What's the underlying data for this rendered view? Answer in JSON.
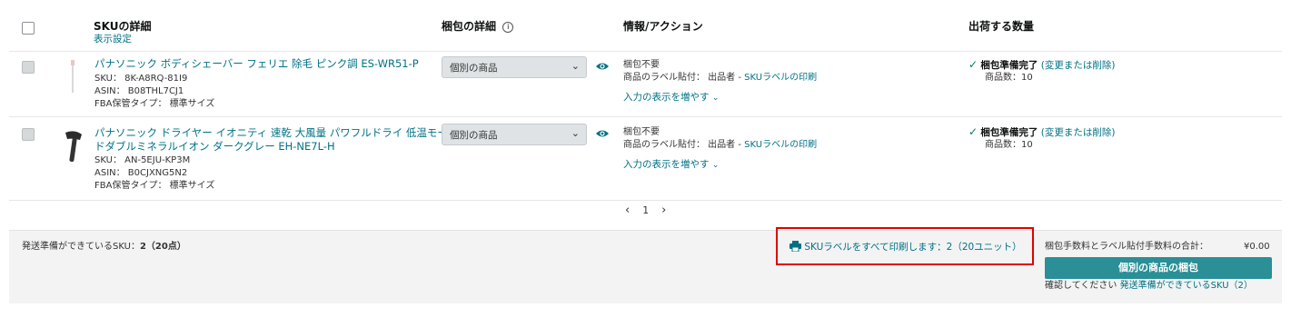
{
  "header": {
    "sku_details": "SKUの詳細",
    "display_settings": "表示設定",
    "packing_details": "梱包の詳細",
    "info_action": "情報/アクション",
    "ship_qty": "出荷する数量"
  },
  "rows": [
    {
      "name_lines": [
        "パナソニック ボディシェーバー フェリエ 除毛 ピンク調 ES-WR51-P"
      ],
      "sku": "SKU： 8K-A8RQ-81I9",
      "asin": "ASIN： B08THL7CJ1",
      "storage": "FBA保管タイプ： 標準サイズ",
      "packing_select": "個別の商品",
      "prep": "梱包不要",
      "label_prefix": "商品のラベル貼付： 出品者 - ",
      "label_link": "SKUラベルの印刷",
      "show_more": "入力の表示を増やす",
      "status": "梱包準備完了",
      "change_link": "(変更または削除)",
      "qty": "商品数：10"
    },
    {
      "name_lines": [
        "パナソニック ドライヤー イオニティ 速乾 大風量 パワフルドライ 低温モー",
        "ドダブルミネラルイオン ダークグレー EH-NE7L-H"
      ],
      "sku": "SKU： AN-5EJU-KP3M",
      "asin": "ASIN： B0CJXNG5N2",
      "storage": "FBA保管タイプ： 標準サイズ",
      "packing_select": "個別の商品",
      "prep": "梱包不要",
      "label_prefix": "商品のラベル貼付： 出品者 - ",
      "label_link": "SKUラベルの印刷",
      "show_more": "入力の表示を増やす",
      "status": "梱包準備完了",
      "change_link": "(変更または削除)",
      "qty": "商品数：10"
    }
  ],
  "pagination": {
    "prev": "‹",
    "page": "1",
    "next": "›"
  },
  "footer": {
    "ready_label": "発送準備ができているSKU：",
    "ready_count": "2（20点）",
    "print_all": "SKUラベルをすべて印刷します：2（20ユニット）",
    "fee_label": "梱包手数料とラベル貼付手数料の合計：",
    "fee_value": "¥0.00",
    "pack_button": "個別の商品の梱包",
    "confirm_prefix": "確認してください",
    "confirm_link": "発送準備ができているSKU（2）"
  },
  "colors": {
    "accent": "#2a8f96",
    "link": "#007185",
    "highlight_box": "#e00000",
    "check": "#067d62"
  }
}
